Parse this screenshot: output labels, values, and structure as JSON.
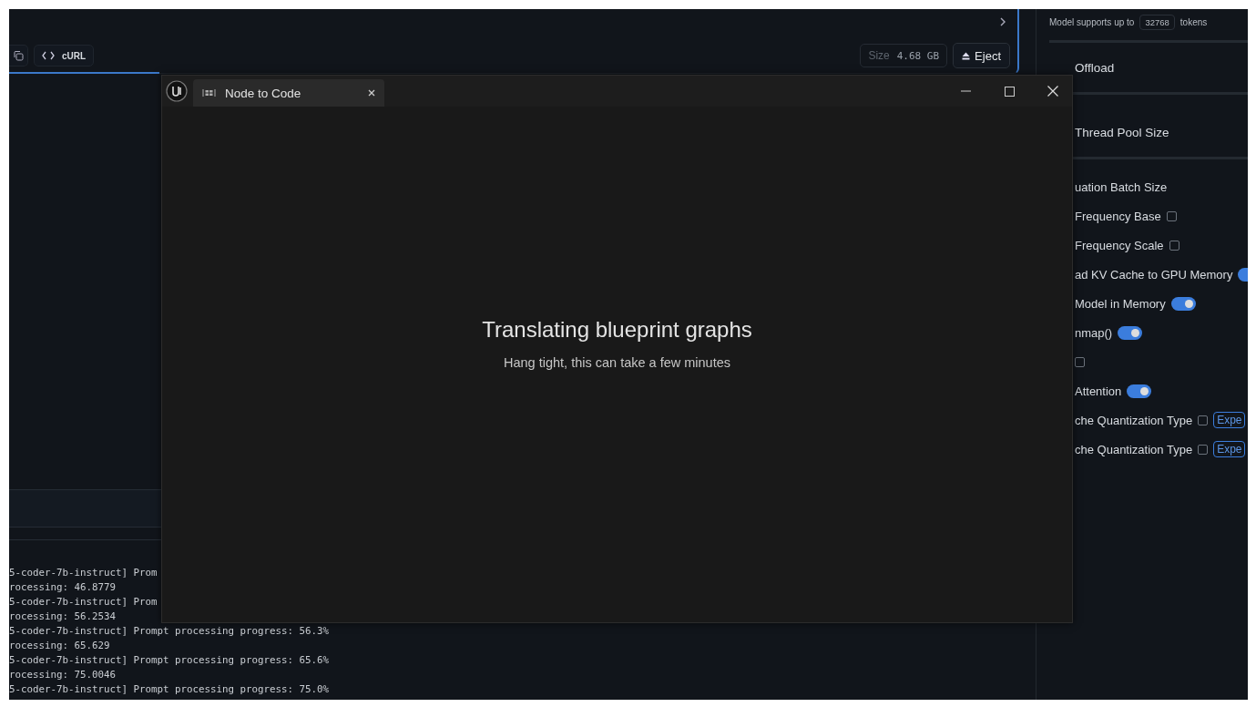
{
  "toolbar": {
    "curl_button": "cURL",
    "size_label": "Size",
    "size_value": "4.68 GB",
    "eject_button": "Eject"
  },
  "log_lines": [
    "5-coder-7b-instruct] Prom",
    "rocessing: 46.8779",
    "5-coder-7b-instruct] Prom",
    "rocessing: 56.2534",
    "5-coder-7b-instruct] Prompt processing progress: 56.3%",
    "rocessing: 65.629",
    "5-coder-7b-instruct] Prompt processing progress: 65.6%",
    "rocessing: 75.0046",
    "5-coder-7b-instruct] Prompt processing progress: 75.0%"
  ],
  "settings": {
    "context_note": {
      "prefix": "Model supports up to",
      "value": "32768",
      "suffix": "tokens"
    },
    "rows": [
      {
        "kind": "heading",
        "label": "Offload"
      },
      {
        "kind": "heading",
        "label": "Thread Pool Size"
      },
      {
        "kind": "plain",
        "label": "uation Batch Size"
      },
      {
        "kind": "checkbox",
        "label": "Frequency Base",
        "checked": false
      },
      {
        "kind": "checkbox",
        "label": "Frequency Scale",
        "checked": false
      },
      {
        "kind": "toggle",
        "label": "ad KV Cache to GPU Memory",
        "on": true
      },
      {
        "kind": "toggle",
        "label": "Model in Memory",
        "on": true
      },
      {
        "kind": "toggle",
        "label": "nmap()",
        "on": true
      },
      {
        "kind": "checkbox",
        "checked": false
      },
      {
        "kind": "toggle",
        "label": "Attention",
        "on": true
      },
      {
        "kind": "checkbox_badge",
        "label": "che Quantization Type",
        "checked": false,
        "badge": "Expe"
      },
      {
        "kind": "checkbox_badge",
        "label": "che Quantization Type",
        "checked": false,
        "badge": "Expe"
      }
    ]
  },
  "dialog": {
    "tab": {
      "label": "Node to Code",
      "selected": true
    },
    "heading": "Translating blueprint graphs",
    "subtitle": "Hang tight, this can take a few minutes"
  }
}
